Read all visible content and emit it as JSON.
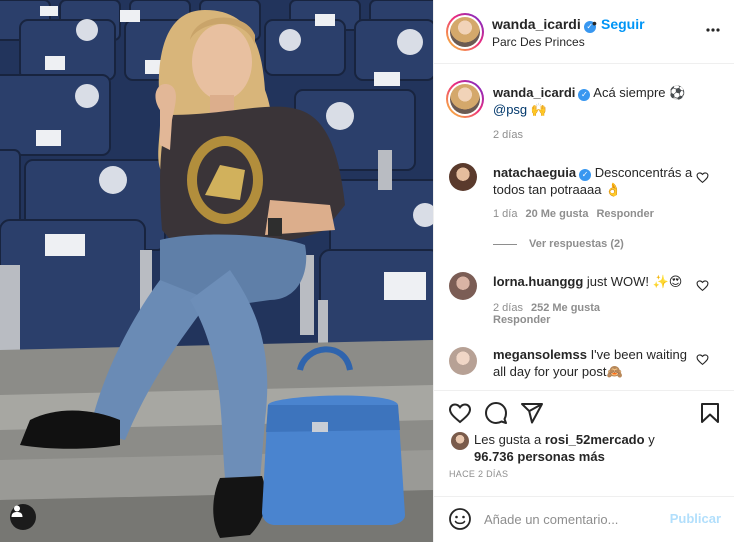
{
  "post": {
    "username": "wanda_icardi",
    "follow_label": "Seguir",
    "location": "Parc Des Princes",
    "caption": "Acá siempre ⚽",
    "caption_mention": "@psg",
    "caption_emoji": "🙌",
    "caption_time": "2 días"
  },
  "comments": [
    {
      "username": "natachaeguia",
      "verified": true,
      "text": "Desconcentrás a todos tan potraaaa 👌",
      "time": "1 día",
      "likes": "20 Me gusta",
      "reply": "Responder",
      "view_replies": "Ver respuestas (2)"
    },
    {
      "username": "lorna.huanggg",
      "verified": false,
      "text": "just WOW! ✨😍",
      "time": "2 días",
      "likes": "252 Me gusta",
      "reply": "Responder"
    },
    {
      "username": "megansolemss",
      "verified": false,
      "text": "I've been waiting all day for your post🙈"
    }
  ],
  "likes": {
    "prefix": "Les gusta a",
    "user": "rosi_52mercado",
    "joiner": "y",
    "count": "96.736 personas más"
  },
  "post_time": "HACE 2 DÍAS",
  "composer": {
    "placeholder": "Añade un comentario...",
    "publish_label": "Publicar"
  },
  "icons": [
    "user-tag-icon",
    "verified-icon",
    "more-icon",
    "heart-icon",
    "comment-icon",
    "share-icon",
    "bookmark-icon",
    "emoji-icon"
  ],
  "colors": {
    "accent": "#0095f6",
    "verified": "#3897f0",
    "muted": "#8e8e8e",
    "publish_disabled": "#b2dffc"
  }
}
